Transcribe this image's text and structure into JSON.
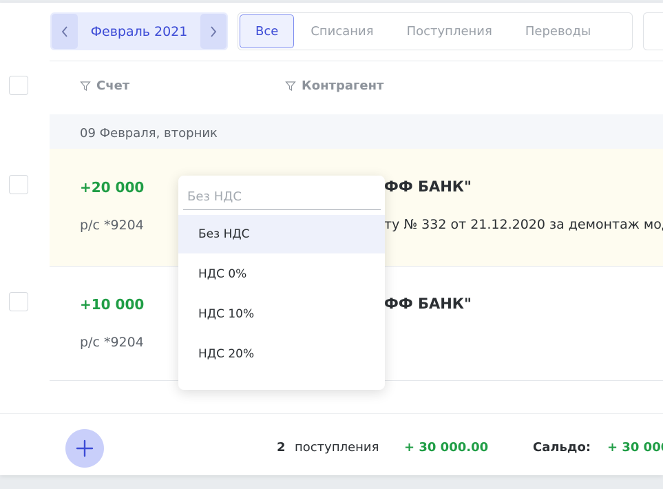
{
  "period": {
    "month_label": "Февраль 2021",
    "prev_icon": "chevron-left-icon",
    "next_icon": "chevron-right-icon"
  },
  "tabs": [
    {
      "label": "Все",
      "active": true
    },
    {
      "label": "Списания",
      "active": false
    },
    {
      "label": "Поступления",
      "active": false
    },
    {
      "label": "Переводы",
      "active": false
    }
  ],
  "table": {
    "columns": [
      {
        "label": "Счет",
        "icon": "filter-icon"
      },
      {
        "label": "Контрагент",
        "icon": "filter-icon"
      }
    ],
    "group_date": "09 Февраля, вторник",
    "rows": [
      {
        "amount": "+20 000",
        "account": "р/с *9204",
        "counterparty": "ФФ БАНК\"",
        "description": "ту № 332 от 21.12.2020 за демонтаж мод"
      },
      {
        "amount": "+10 000",
        "account": "р/с *9204",
        "counterparty": "ФФ БАНК\"",
        "description": ""
      }
    ]
  },
  "vat_dropdown": {
    "placeholder": "Без НДС",
    "options": [
      {
        "label": "Без НДС",
        "selected": true
      },
      {
        "label": "НДС 0%",
        "selected": false
      },
      {
        "label": "НДС 10%",
        "selected": false
      },
      {
        "label": "НДС 20%",
        "selected": false
      }
    ]
  },
  "footer": {
    "count": "2",
    "count_label": "поступления",
    "total": "+ 30 000.00",
    "saldo_label": "Сальдо:",
    "saldo_value": "+ 30 000",
    "add_icon": "plus-icon"
  },
  "colors": {
    "accent": "#3c4bd6",
    "income": "#1f9d45",
    "highlight_row": "#fefcf0"
  }
}
